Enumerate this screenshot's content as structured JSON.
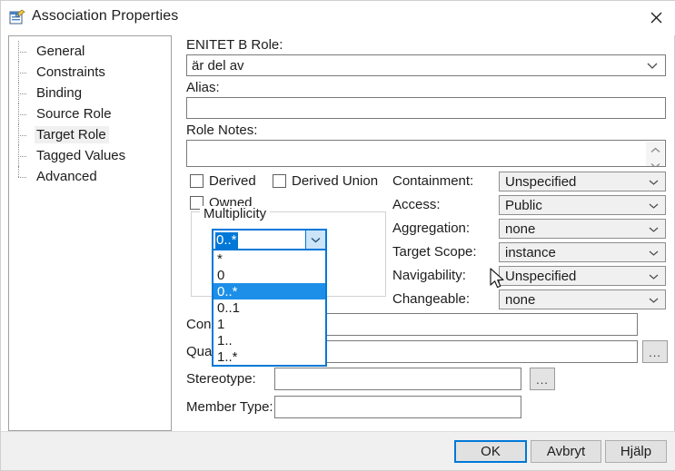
{
  "window": {
    "title": "Association Properties",
    "icon": "association-properties-icon",
    "close_label": "✕"
  },
  "sidebar": {
    "items": [
      {
        "label": "General",
        "selected": false
      },
      {
        "label": "Constraints",
        "selected": false
      },
      {
        "label": "Binding",
        "selected": false
      },
      {
        "label": "Source Role",
        "selected": false
      },
      {
        "label": "Target Role",
        "selected": true
      },
      {
        "label": "Tagged Values",
        "selected": false
      },
      {
        "label": "Advanced",
        "selected": false
      }
    ]
  },
  "form": {
    "role_label": "ENITET B Role:",
    "role_value": "är del av",
    "alias_label": "Alias:",
    "alias_value": "",
    "notes_label": "Role Notes:",
    "notes_value": "",
    "derived_label": "Derived",
    "derived_union_label": "Derived Union",
    "owned_label": "Owned",
    "multiplicity_group_label": "Multiplicity",
    "multiplicity_value": "0..*",
    "multiplicity_options": [
      "*",
      "0",
      "0..*",
      "0..1",
      "1",
      "1..",
      "1..*"
    ],
    "multiplicity_selected_index": 2,
    "constraint_label": "Constraint:",
    "constraint_value": "",
    "qualifier_label": "Qualifier:",
    "qualifier_value": "",
    "stereotype_label": "Stereotype:",
    "stereotype_value": "",
    "member_type_label": "Member Type:",
    "member_type_value": "",
    "ellipsis_label": "..."
  },
  "properties": [
    {
      "label": "Containment:",
      "value": "Unspecified"
    },
    {
      "label": "Access:",
      "value": "Public"
    },
    {
      "label": "Aggregation:",
      "value": "none"
    },
    {
      "label": "Target Scope:",
      "value": "instance"
    },
    {
      "label": "Navigability:",
      "value": "Unspecified"
    },
    {
      "label": "Changeable:",
      "value": "none"
    }
  ],
  "footer": {
    "ok_label": "OK",
    "cancel_label": "Avbryt",
    "help_label": "Hjälp"
  },
  "colors": {
    "accent": "#0078d7",
    "list_highlight": "#1e8fe8",
    "control_grey": "#f0f0f0",
    "button_grey": "#e1e1e1"
  }
}
